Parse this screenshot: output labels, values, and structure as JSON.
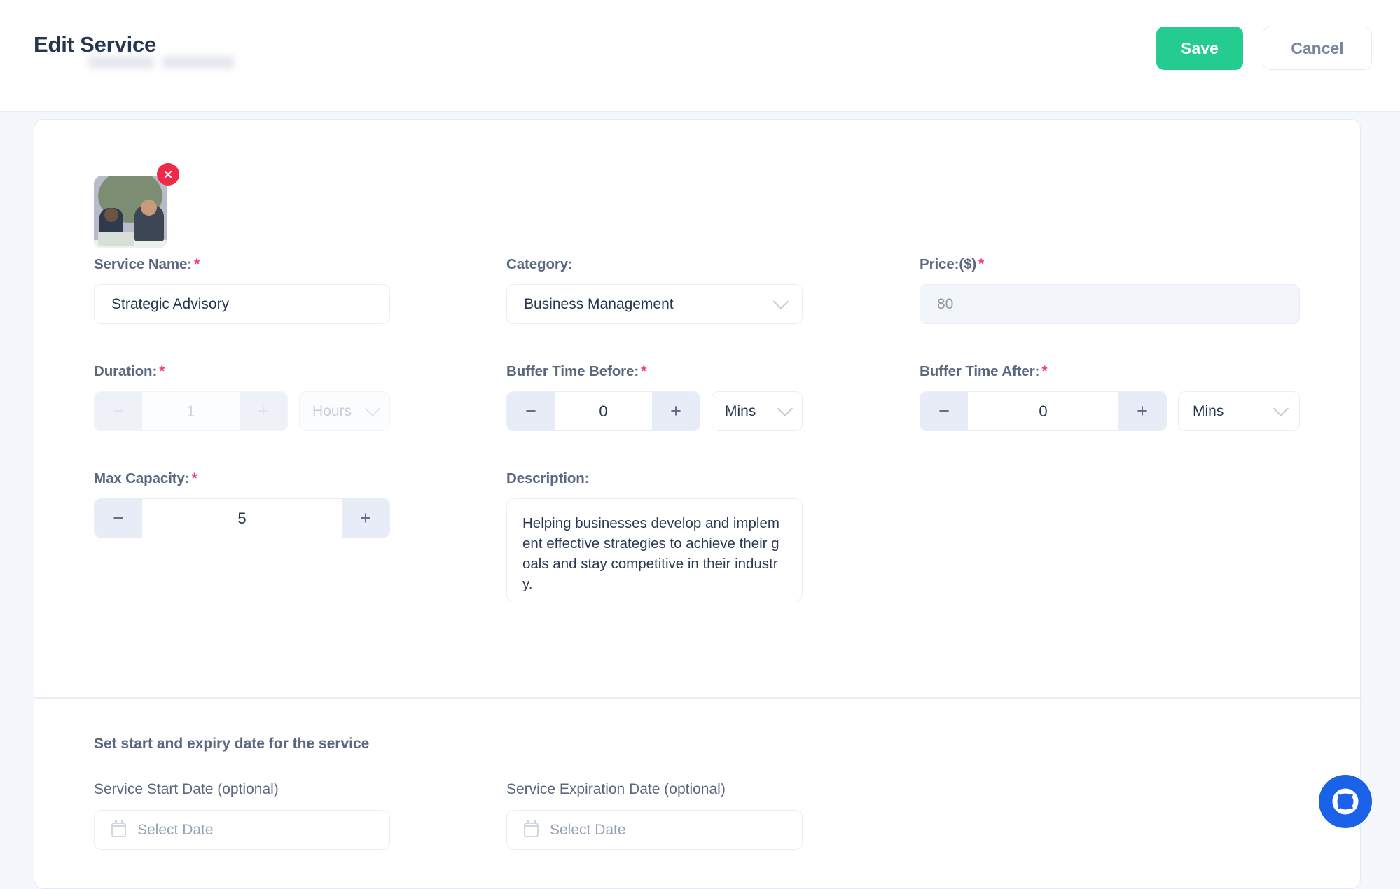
{
  "header": {
    "title": "Edit Service",
    "subtitle_redacted": "",
    "save_label": "Save",
    "cancel_label": "Cancel"
  },
  "media": {
    "thumbnail_alt": "service-photo",
    "remove_label": "×"
  },
  "form": {
    "service_name": {
      "label": "Service Name:",
      "required": "*",
      "value": "Strategic Advisory"
    },
    "category": {
      "label": "Category:",
      "required": "",
      "value": "Business Management"
    },
    "price": {
      "label": "Price:($)",
      "required": "*",
      "value": "80",
      "disabled": true
    },
    "duration": {
      "label": "Duration:",
      "required": "*",
      "value": "1",
      "minus": "−",
      "plus": "+",
      "unit": "Hours",
      "disabled": true
    },
    "buffer_before": {
      "label": "Buffer Time Before:",
      "required": "*",
      "value": "0",
      "minus": "−",
      "plus": "+",
      "unit": "Mins"
    },
    "buffer_after": {
      "label": "Buffer Time After:",
      "required": "*",
      "value": "0",
      "minus": "−",
      "plus": "+",
      "unit": "Mins"
    },
    "max_capacity": {
      "label": "Max Capacity:",
      "required": "*",
      "value": "5",
      "minus": "−",
      "plus": "+"
    },
    "description": {
      "label": "Description:",
      "required": "",
      "value": "Helping businesses develop and implement effective strategies to achieve their goals and stay competitive in their industry."
    }
  },
  "dates": {
    "section_title": "Set start and expiry date for the service",
    "start": {
      "label": "Service Start Date (optional)",
      "placeholder": "Select Date"
    },
    "expiration": {
      "label": "Service Expiration Date (optional)",
      "placeholder": "Select Date"
    }
  },
  "support": {
    "icon": "lifebuoy-icon"
  },
  "colors": {
    "accent_green": "#24cd8f",
    "danger_red": "#f02849",
    "required_red": "#f0426b",
    "help_blue": "#1a63e8",
    "text_navy": "#27354f",
    "label_slate": "#5a6780",
    "page_bg": "#f4f7fb"
  }
}
